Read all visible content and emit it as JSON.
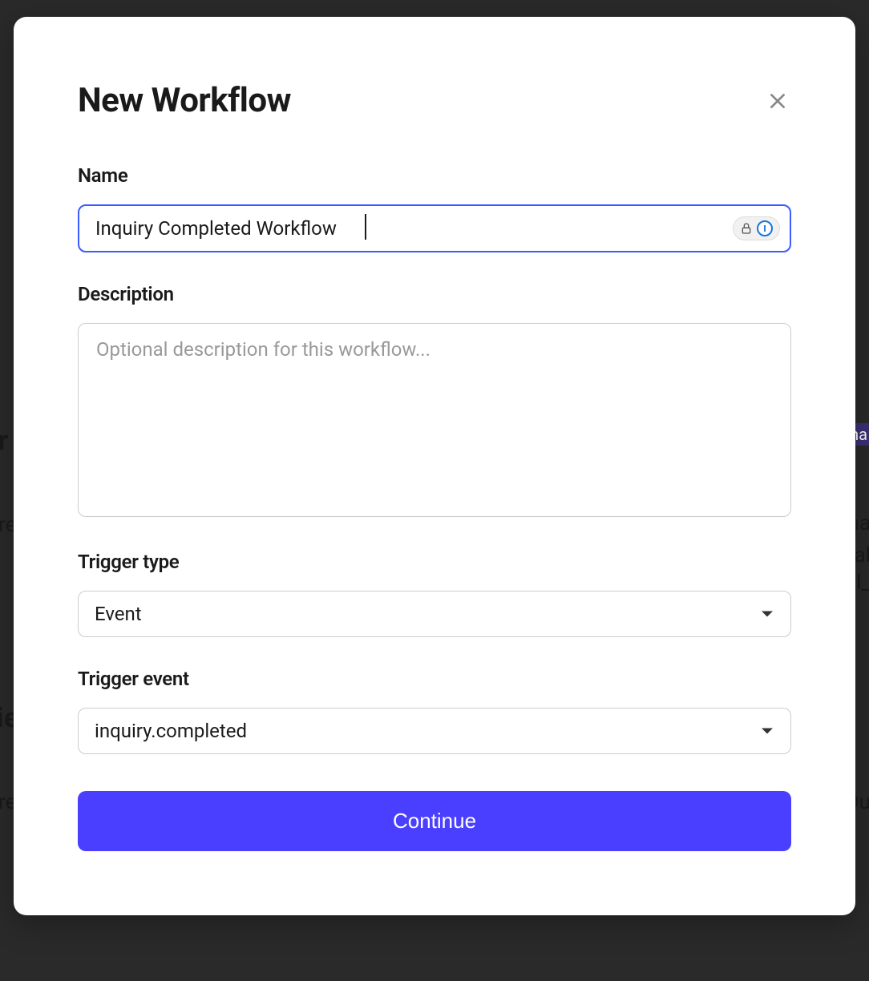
{
  "modal": {
    "title": "New Workflow",
    "fields": {
      "name": {
        "label": "Name",
        "value": "Inquiry Completed Workflow"
      },
      "description": {
        "label": "Description",
        "placeholder": "Optional description for this workflow...",
        "value": ""
      },
      "triggerType": {
        "label": "Trigger type",
        "value": "Event"
      },
      "triggerEvent": {
        "label": "Trigger event",
        "value": "inquiry.completed"
      }
    },
    "submitLabel": "Continue"
  },
  "background": {
    "fragments": [
      "r",
      "re",
      "re",
      "re",
      "nha",
      "ha",
      "al",
      "oll_",
      "Ou"
    ]
  }
}
